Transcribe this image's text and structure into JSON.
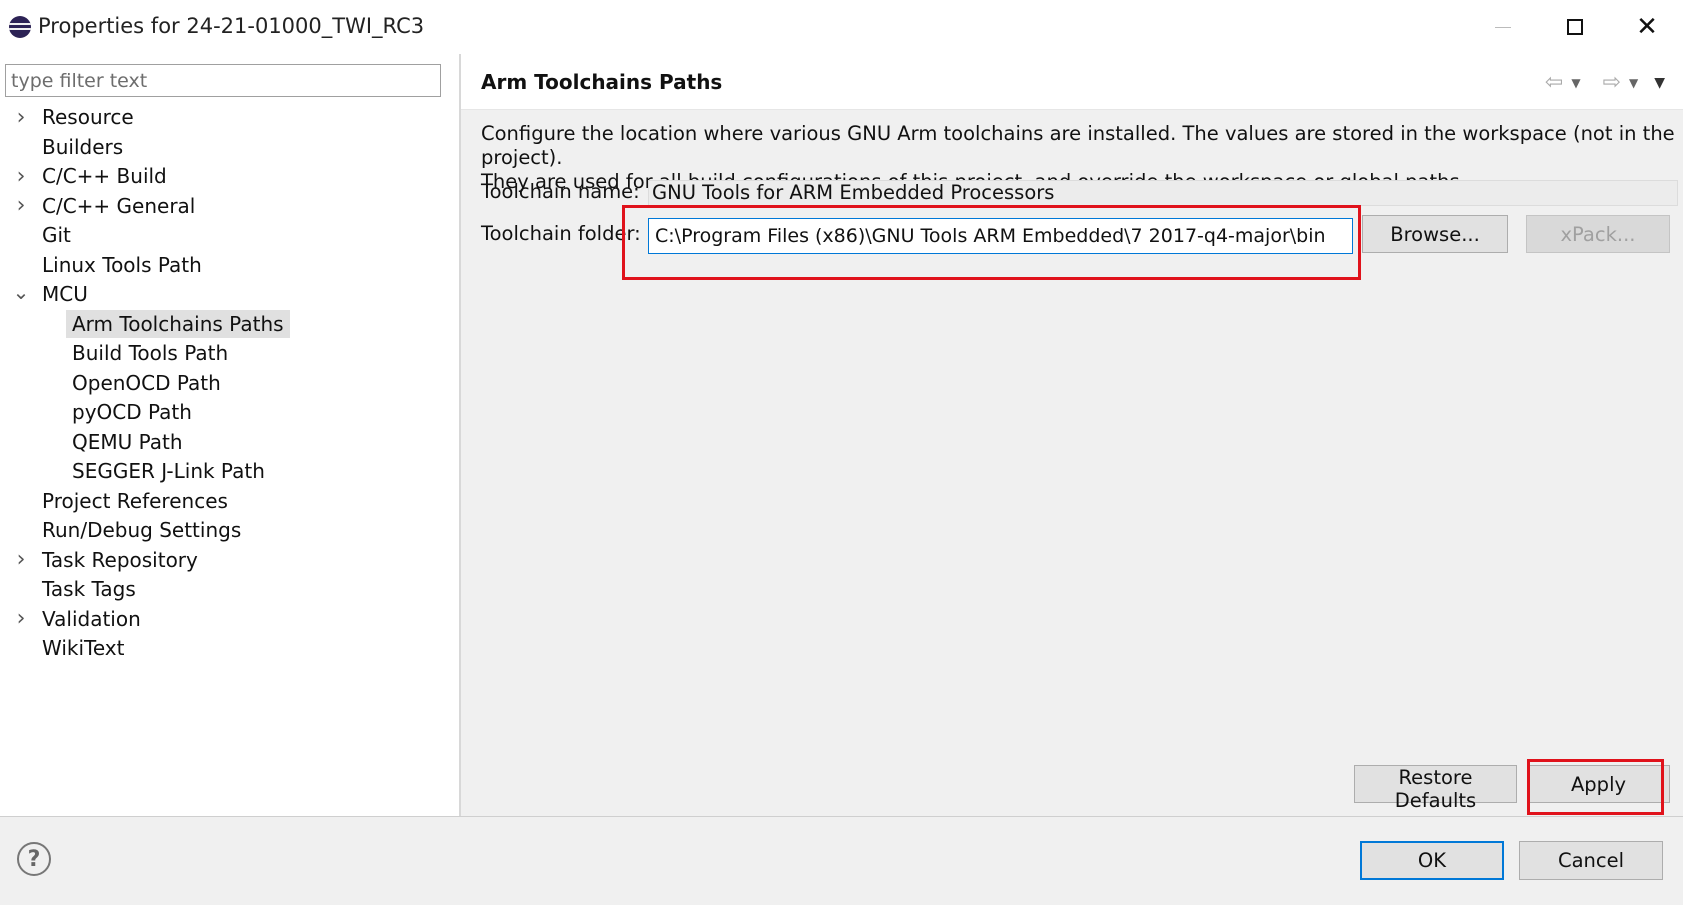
{
  "window": {
    "title": "Properties for 24-21-01000_TWI_RC3",
    "minimize_glyph": "—",
    "maximize_glyph": "☐",
    "close_glyph": "✕"
  },
  "filter": {
    "placeholder": "type filter text",
    "value": ""
  },
  "tree": {
    "items": [
      {
        "label": "Resource",
        "expandable": true,
        "expanded": false
      },
      {
        "label": "Builders",
        "expandable": false
      },
      {
        "label": "C/C++ Build",
        "expandable": true,
        "expanded": false
      },
      {
        "label": "C/C++ General",
        "expandable": true,
        "expanded": false
      },
      {
        "label": "Git",
        "expandable": false
      },
      {
        "label": "Linux Tools Path",
        "expandable": false
      },
      {
        "label": "MCU",
        "expandable": true,
        "expanded": true
      },
      {
        "label": "Arm Toolchains Paths",
        "child": true,
        "selected": true
      },
      {
        "label": "Build Tools Path",
        "child": true
      },
      {
        "label": "OpenOCD Path",
        "child": true
      },
      {
        "label": "pyOCD Path",
        "child": true
      },
      {
        "label": "QEMU Path",
        "child": true
      },
      {
        "label": "SEGGER J-Link Path",
        "child": true
      },
      {
        "label": "Project References",
        "expandable": false
      },
      {
        "label": "Run/Debug Settings",
        "expandable": false
      },
      {
        "label": "Task Repository",
        "expandable": true,
        "expanded": false
      },
      {
        "label": "Task Tags",
        "expandable": false
      },
      {
        "label": "Validation",
        "expandable": true,
        "expanded": false
      },
      {
        "label": "WikiText",
        "expandable": false
      }
    ]
  },
  "page": {
    "title": "Arm Toolchains Paths",
    "nav": {
      "back_icon": "back-arrow-icon",
      "forward_icon": "forward-arrow-icon",
      "menu_icon": "view-menu-icon"
    },
    "description_line1": "Configure the location where various GNU Arm toolchains are installed. The values are stored in the workspace (not in the project).",
    "description_line2": "They are used for all build configurations of this project, and override the workspace or global paths.",
    "toolchain_name_label": "Toolchain name:",
    "toolchain_name_value": "GNU Tools for ARM Embedded Processors",
    "toolchain_folder_label": "Toolchain folder:",
    "toolchain_folder_value": "C:\\Program Files (x86)\\GNU Tools ARM Embedded\\7 2017-q4-major\\bin",
    "browse_label": "Browse...",
    "xpack_label": "xPack...",
    "restore_defaults_label": "Restore Defaults",
    "apply_label": "Apply"
  },
  "footer": {
    "help_glyph": "?",
    "ok_label": "OK",
    "cancel_label": "Cancel"
  },
  "colors": {
    "highlight": "#e0121b",
    "focus": "#0078d7",
    "panel_bg": "#f0f0f0"
  }
}
